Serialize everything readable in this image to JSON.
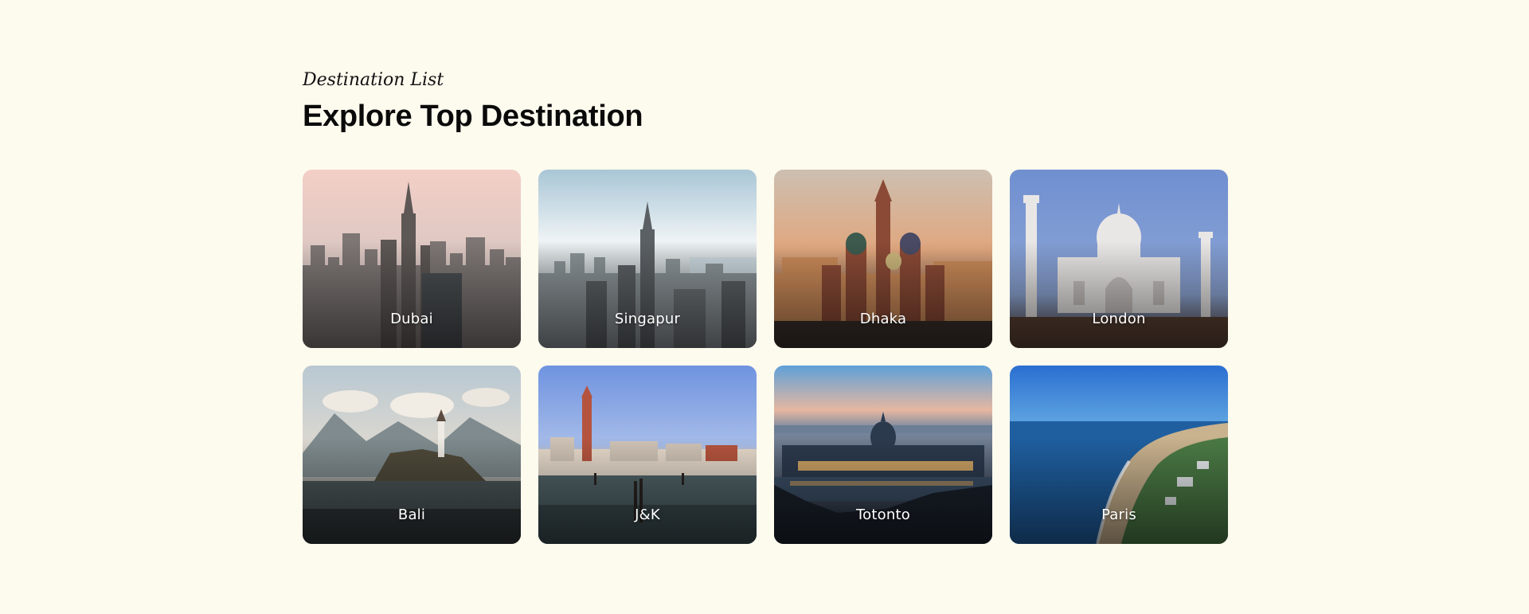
{
  "header": {
    "eyebrow": "Destination List",
    "title": "Explore Top Destination"
  },
  "destinations": [
    {
      "label": "Dubai"
    },
    {
      "label": "Singapur"
    },
    {
      "label": "Dhaka"
    },
    {
      "label": "London"
    },
    {
      "label": "Bali"
    },
    {
      "label": "J&K"
    },
    {
      "label": "Totonto"
    },
    {
      "label": "Paris"
    }
  ],
  "colors": {
    "background": "#fdfaee",
    "text": "#0a0a0a",
    "card_label": "#ffffff"
  }
}
